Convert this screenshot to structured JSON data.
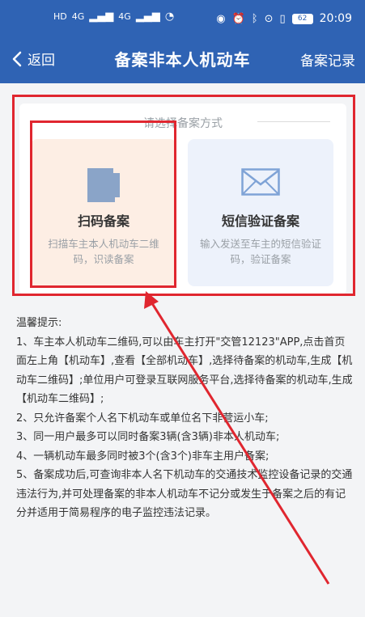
{
  "statusbar": {
    "left_icons": [
      "HD",
      "4G",
      "4G",
      "wechat"
    ],
    "time": "20:09",
    "battery": "62"
  },
  "navbar": {
    "back_label": "返回",
    "title": "备案非本人机动车",
    "right_label": "备案记录"
  },
  "card": {
    "subtitle": "请选择备案方式",
    "options": [
      {
        "title": "扫码备案",
        "desc": "扫描车主本人机动车二维码，识读备案",
        "icon": "qr-scan-icon"
      },
      {
        "title": "短信验证备案",
        "desc": "输入发送至车主的短信验证码，验证备案",
        "icon": "envelope-icon"
      }
    ]
  },
  "tips": {
    "title": "温馨提示:",
    "items": [
      "1、车主本人机动车二维码,可以由车主打开\"交管12123\"APP,点击首页面左上角【机动车】,查看【全部机动车】,选择待备案的机动车,生成【机动车二维码】;单位用户可登录互联网服务平台,选择待备案的机动车,生成【机动车二维码】;",
      "2、只允许备案个人名下机动车或单位名下非营运小车;",
      "3、同一用户最多可以同时备案3辆(含3辆)非本人机动车;",
      "4、一辆机动车最多同时被3个(含3个)非车主用户备案;",
      "5、备案成功后,可查询非本人名下机动车的交通技术监控设备记录的交通违法行为,并可处理备案的非本人机动车不记分或发生于备案之后的有记分并适用于简易程序的电子监控违法记录。"
    ]
  },
  "colors": {
    "header_blue": "#2f63b4",
    "annotation_red": "#e0262f",
    "scan_bg": "#fdeee4",
    "sms_bg": "#edf2fb",
    "sms_icon": "#7fa3d6"
  }
}
